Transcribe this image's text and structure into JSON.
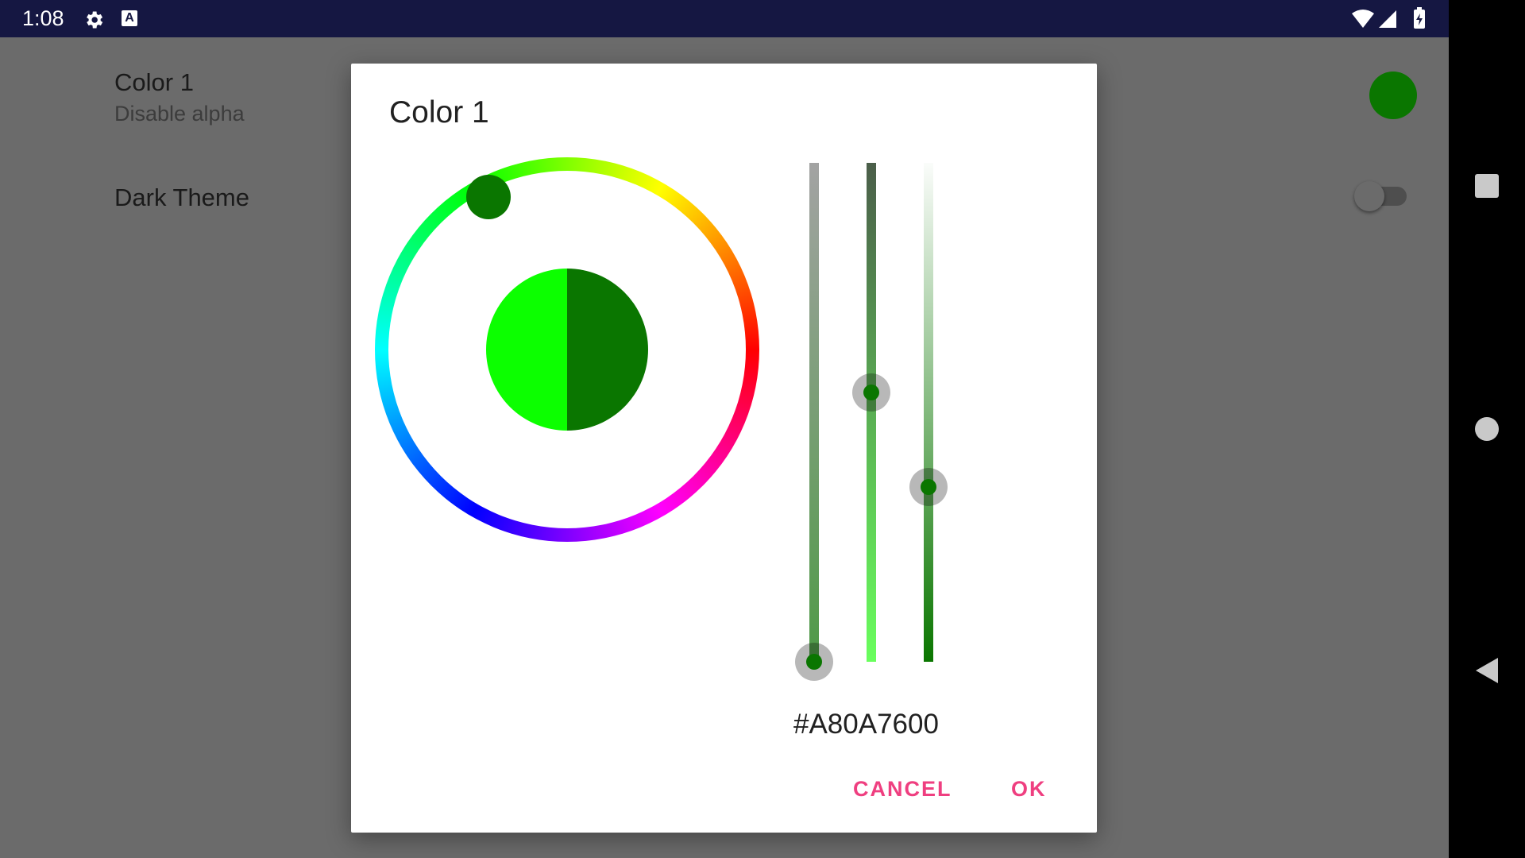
{
  "status_bar": {
    "time": "1:08",
    "left_icons": [
      "gear-icon",
      "text-a-icon"
    ],
    "right_icons": [
      "wifi-icon",
      "cell-signal-icon",
      "battery-charging-icon"
    ]
  },
  "nav_bar": {
    "buttons": [
      "recents-square-icon",
      "home-circle-icon",
      "back-triangle-icon"
    ]
  },
  "settings": {
    "items": [
      {
        "title": "Color 1",
        "summary": "Disable alpha",
        "swatch_color": "#0A7600"
      },
      {
        "title": "Dark Theme",
        "switch_on": false
      }
    ]
  },
  "dialog": {
    "title": "Color 1",
    "hex": "#A80A7600",
    "old_color": "#0CFF00",
    "new_color": "#0A7600",
    "sliders": [
      {
        "name": "alpha",
        "level": 0.0
      },
      {
        "name": "saturation",
        "level": 0.54
      },
      {
        "name": "value",
        "level": 0.35
      }
    ],
    "cancel_label": "CANCEL",
    "ok_label": "OK"
  },
  "colors": {
    "accent": "#EF3F80",
    "status_bar": "#151742",
    "scrim": "#6B6B6B"
  }
}
